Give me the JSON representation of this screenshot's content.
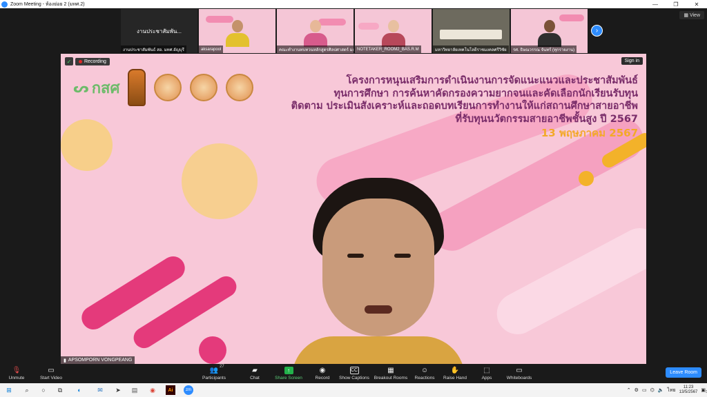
{
  "window": {
    "title": "Zoom Meeting - ห้องย่อย 2 (มทศ.2)",
    "controls": [
      "—",
      "❐",
      "✕"
    ]
  },
  "gallery": {
    "tiles": [
      {
        "name": "งานประชาสัมพันธ์ สอ. มทศ.อัญบุรี",
        "label": "งานประชาสัมพัน...",
        "type": "label"
      },
      {
        "name": "aksarapool",
        "type": "video"
      },
      {
        "name": "คณะทำงานทบทวนหลักสูตรศิลปศาสตร์ มธ.",
        "type": "video"
      },
      {
        "name": "NOTETAKER_ROOM2_BAS.R.M",
        "type": "video"
      },
      {
        "name": "มหาวิทยาลัยเทคโนโลยีราชมงคลศรีวิชัย",
        "type": "video"
      },
      {
        "name": "รศ. ธิษณวรรณ จันทร์ (ทุกรายงาน)",
        "type": "video"
      }
    ],
    "view_label": "View"
  },
  "main": {
    "recording_label": "Recording",
    "signin_label": "Sign in",
    "logo_text": "กสศ",
    "headline": [
      "โครงการหนุนเสริมการดำเนินงานการจัดแนะแนวและประชาสัมพันธ์",
      "ทุนการศึกษา การค้นหาคัดกรองความยากจนและคัดเลือกนักเรียนรับทุน",
      "ติดตาม ประเมินสังเคราะห์และถอดบทเรียนการทำงานให้แก่สถานศึกษาสายอาชีพ",
      "ที่รับทุนนวัตกรรมสายอาชีพชั้นสูง ปี 2567"
    ],
    "date": "13 พฤษภาคม 2567",
    "speaker_name": "APSOMPORN VONGPEANG"
  },
  "toolbar": {
    "unmute": "Unmute",
    "start_video": "Start Video",
    "participants": "Participants",
    "participants_count": "27",
    "chat": "Chat",
    "share_screen": "Share Screen",
    "record": "Record",
    "show_captions": "Show Captions",
    "breakout_rooms": "Breakout Rooms",
    "reactions": "Reactions",
    "raise_hand": "Raise Hand",
    "apps": "Apps",
    "whiteboards": "Whiteboards",
    "leave_room": "Leave Room"
  },
  "taskbar": {
    "language": "ไทย",
    "time": "11:23",
    "date": "13/5/2567",
    "notification_count": "3"
  },
  "colors": {
    "accent": "#2d8cff",
    "headline": "#7a2d6a",
    "date": "#f3a928",
    "share": "#23b24b"
  }
}
